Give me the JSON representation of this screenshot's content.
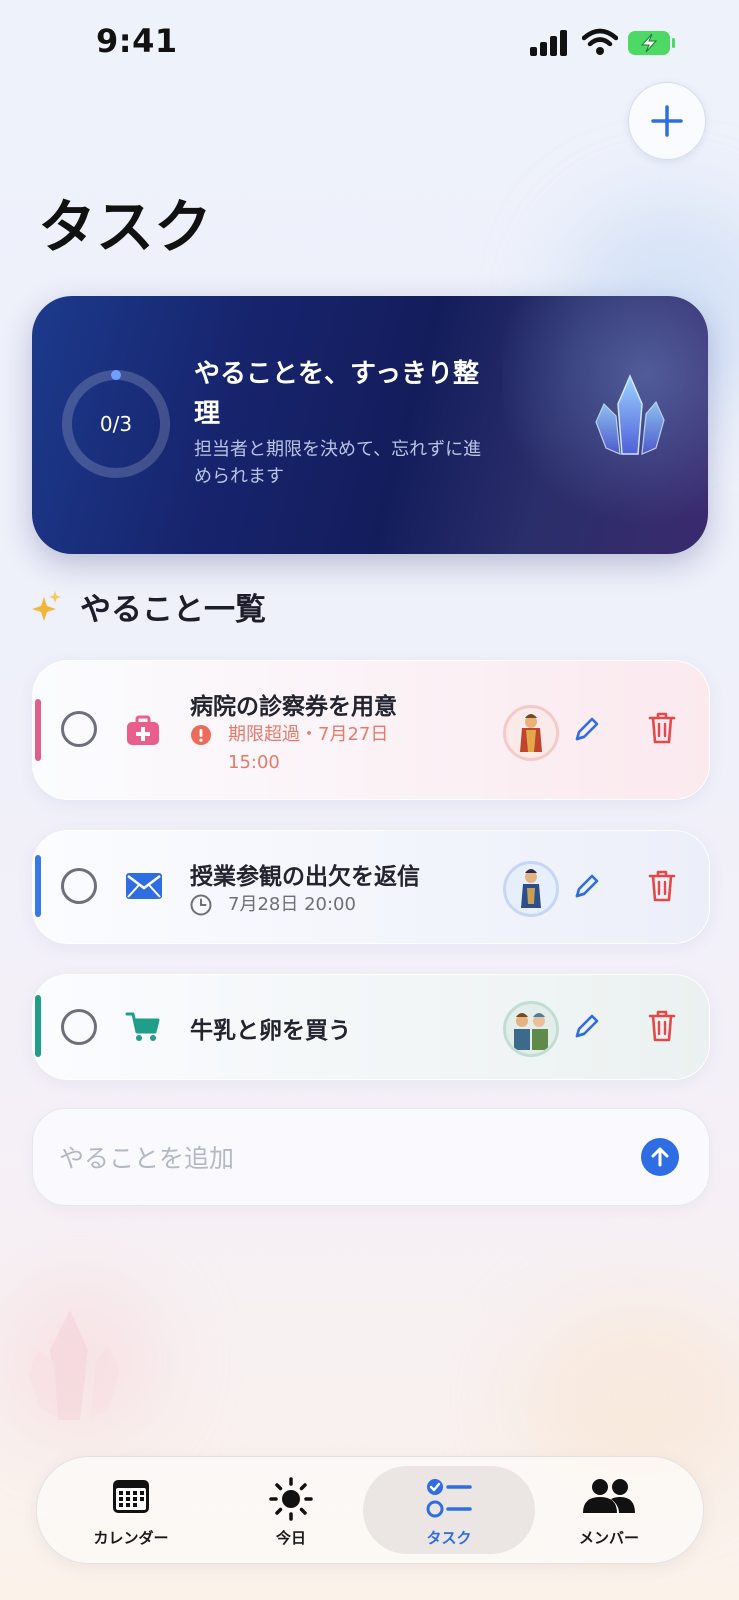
{
  "status_bar": {
    "time": "9:41"
  },
  "header": {
    "title": "タスク",
    "add_icon": "plus-icon"
  },
  "hero": {
    "progress_text": "0/3",
    "progress_fraction": 0,
    "title": "やることを、すっきり整理",
    "subtitle": "担当者と期限を決めて、忘れずに進められます",
    "icon": "crystal-icon"
  },
  "section": {
    "title": "やること一覧",
    "icon": "sparkles-icon"
  },
  "tasks": [
    {
      "title": "病院の診察券を用意",
      "meta": "期限超過・7月27日 15:00",
      "meta_icon": "alert-icon",
      "category_icon": "medical-bag-icon",
      "accent": "#e0608a",
      "meta_color": "#e77b6b",
      "tint": "#fbe9ee"
    },
    {
      "title": "授業参観の出欠を返信",
      "meta": "7月28日 20:00",
      "meta_icon": "clock-icon",
      "category_icon": "mail-icon",
      "accent": "#3a78e6",
      "meta_color": "#6c6f7c",
      "tint": "#eceff9"
    },
    {
      "title": "牛乳と卵を買う",
      "meta": "",
      "meta_icon": "",
      "category_icon": "cart-icon",
      "accent": "#1f9e8a",
      "meta_color": "#6c6f7c",
      "tint": "#ebf1f0"
    }
  ],
  "composer": {
    "placeholder": "やることを追加",
    "value": "",
    "send_icon": "arrow-up-icon"
  },
  "tabbar": {
    "tabs": [
      {
        "label": "カレンダー",
        "icon": "calendar-icon",
        "active": false
      },
      {
        "label": "今日",
        "icon": "sun-icon",
        "active": false
      },
      {
        "label": "タスク",
        "icon": "checklist-icon",
        "active": true
      },
      {
        "label": "メンバー",
        "icon": "people-icon",
        "active": false
      }
    ]
  },
  "colors": {
    "accent": "#2f6de3",
    "danger": "#e54848"
  }
}
